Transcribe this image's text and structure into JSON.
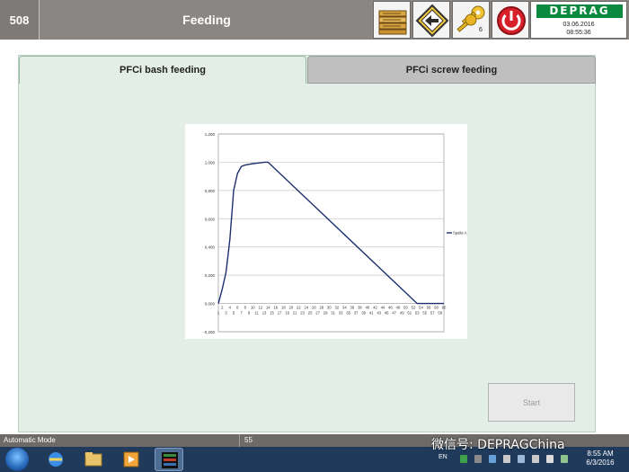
{
  "header": {
    "screen_id": "508",
    "title": "Feeding",
    "key_count": "6",
    "logo": "DEPRAG",
    "date": "03.06.2016",
    "time": "08:55:36"
  },
  "tabs": [
    {
      "label": "PFCi bash feeding",
      "active": true
    },
    {
      "label": "PFCi screw feeding",
      "active": false
    }
  ],
  "start_button": {
    "label": "Start",
    "enabled": false
  },
  "chart_data": {
    "type": "line",
    "title": "",
    "xlabel": "",
    "ylabel": "",
    "ylim": [
      -0.2,
      1.2
    ],
    "xlim": [
      1,
      60
    ],
    "y_ticks": [
      "1,200",
      "1,000",
      "0,800",
      "0,600",
      "0,400",
      "0,200",
      "0,000",
      "-0,200"
    ],
    "x_ticks_top": [
      "2",
      "4",
      "6",
      "8",
      "10",
      "12",
      "14",
      "16",
      "18",
      "20",
      "22",
      "24",
      "26",
      "28",
      "30",
      "32",
      "34",
      "36",
      "38",
      "40",
      "42",
      "44",
      "46",
      "48",
      "50",
      "52",
      "54",
      "56",
      "58",
      "60"
    ],
    "x_ticks_bottom": [
      "1",
      "3",
      "5",
      "7",
      "9",
      "11",
      "13",
      "15",
      "17",
      "19",
      "21",
      "23",
      "25",
      "27",
      "29",
      "31",
      "33",
      "35",
      "37",
      "39",
      "41",
      "43",
      "45",
      "47",
      "49",
      "51",
      "53",
      "55",
      "57",
      "59"
    ],
    "legend_position": "right",
    "grid": true,
    "series": [
      {
        "name": "Spalte A",
        "color": "#1c2f6e",
        "x": [
          1,
          2,
          3,
          4,
          5,
          6,
          7,
          8,
          9,
          10,
          11,
          12,
          13,
          14,
          53,
          54,
          55,
          56,
          57,
          58,
          59,
          60
        ],
        "y": [
          0.0,
          0.1,
          0.22,
          0.45,
          0.8,
          0.92,
          0.97,
          0.98,
          0.985,
          0.99,
          0.993,
          0.996,
          1.0,
          1.0,
          0.0,
          0.0,
          0.0,
          0.0,
          0.0,
          0.0,
          0.0,
          0.0
        ]
      }
    ]
  },
  "status_bar": {
    "mode": "Automatic Mode",
    "value": "55"
  },
  "taskbar": {
    "language": "EN",
    "time": "8:55 AM",
    "date": "6/3/2016"
  },
  "watermark": "微信号: DEPRAGChina",
  "colors": {
    "header_bg": "#8a8684",
    "panel_bg": "#e3efe6",
    "logo_green": "#0b8a3f",
    "power_red": "#d8202a",
    "series_line": "#1c2f6e"
  },
  "icons": {
    "toolbar": [
      "file-list-icon",
      "diamond-arrow-icon",
      "keys-icon",
      "power-icon"
    ]
  }
}
